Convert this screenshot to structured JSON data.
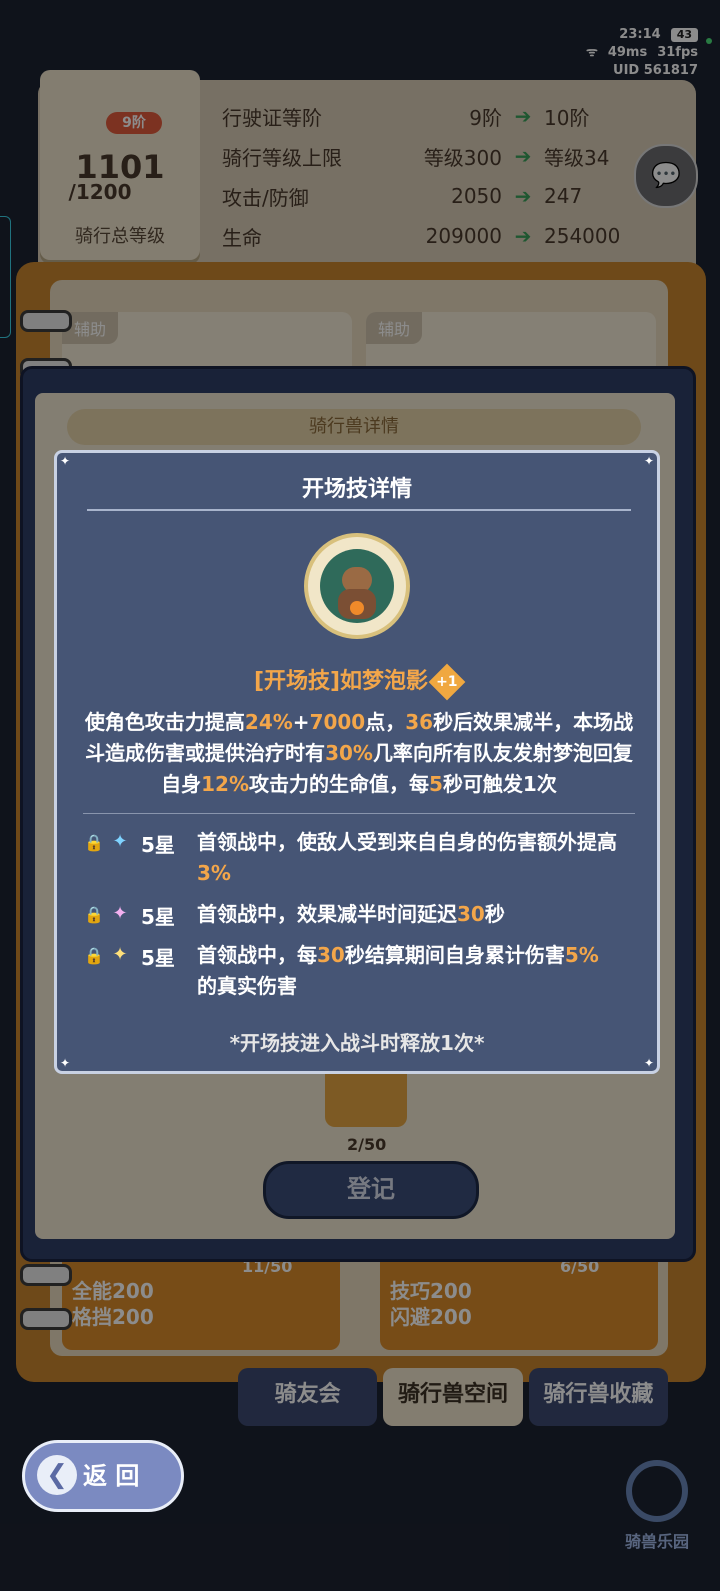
{
  "status_bar": {
    "time": "23:14",
    "battery": "43",
    "ping": "49ms",
    "fps": "31fps",
    "uid": "UID 561817"
  },
  "license": {
    "tier_badge": "9阶",
    "total_level": "1101",
    "level_max": "/1200",
    "caption": "骑行总等级",
    "rows": [
      {
        "label": "行驶证等阶",
        "current": "9阶",
        "next": "10阶"
      },
      {
        "label": "骑行等级上限",
        "current": "等级300",
        "next": "等级34"
      },
      {
        "label": "攻击/防御",
        "current": "2050",
        "next": "247"
      },
      {
        "label": "生命",
        "current": "209000",
        "next": "254000"
      }
    ]
  },
  "album": {
    "card_tags": [
      "辅助",
      "辅助"
    ],
    "left_card_bottom": [
      "全能200",
      "格挡200"
    ],
    "right_card_bottom": [
      "技巧200",
      "闪避200"
    ],
    "left_count": "11/50",
    "right_count": "6/50"
  },
  "detail_modal": {
    "title": "骑行兽详情",
    "count": "2/50",
    "register_label": "登记"
  },
  "popup": {
    "title": "开场技详情",
    "skill_name": "[开场技]如梦泡影",
    "skill_plus": "+1",
    "description": [
      {
        "text": "使角色攻击力提高",
        "hl": false
      },
      {
        "text": "24%",
        "hl": true
      },
      {
        "text": "+",
        "hl": false
      },
      {
        "text": "7000",
        "hl": true
      },
      {
        "text": "点，",
        "hl": false
      },
      {
        "text": "36",
        "hl": true
      },
      {
        "text": "秒后效果减半，本场战斗造成伤害或提供治疗时有",
        "hl": false
      },
      {
        "text": "30%",
        "hl": true
      },
      {
        "text": "几率向所有队友发射梦泡回复自身",
        "hl": false
      },
      {
        "text": "12%",
        "hl": true
      },
      {
        "text": "攻击力的生命值，每",
        "hl": false
      },
      {
        "text": "5",
        "hl": true
      },
      {
        "text": "秒可触发1次",
        "hl": false
      }
    ],
    "star_effects": [
      {
        "level": "5星",
        "spark_color": "#7fd3ff",
        "parts": [
          {
            "text": "首领战中，使敌人受到来自自身的伤害额外提高",
            "hl": false
          },
          {
            "text": "3%",
            "hl": true
          }
        ]
      },
      {
        "level": "5星",
        "spark_color": "#f3b0f0",
        "parts": [
          {
            "text": "首领战中，效果减半时间延迟",
            "hl": false
          },
          {
            "text": "30",
            "hl": true
          },
          {
            "text": "秒",
            "hl": false
          }
        ]
      },
      {
        "level": "5星",
        "spark_color": "#ffe07a",
        "parts": [
          {
            "text": "首领战中，每",
            "hl": false
          },
          {
            "text": "30",
            "hl": true
          },
          {
            "text": "秒结算期间自身累计伤害",
            "hl": false
          },
          {
            "text": "5%",
            "hl": true
          },
          {
            "text": "的真实伤害",
            "hl": false
          }
        ]
      }
    ],
    "note": "*开场技进入战斗时释放1次*"
  },
  "bottom_tabs": [
    "骑友会",
    "骑行兽空间",
    "骑行兽收藏"
  ],
  "back_label": "返 回",
  "park_logo": "骑兽乐园"
}
